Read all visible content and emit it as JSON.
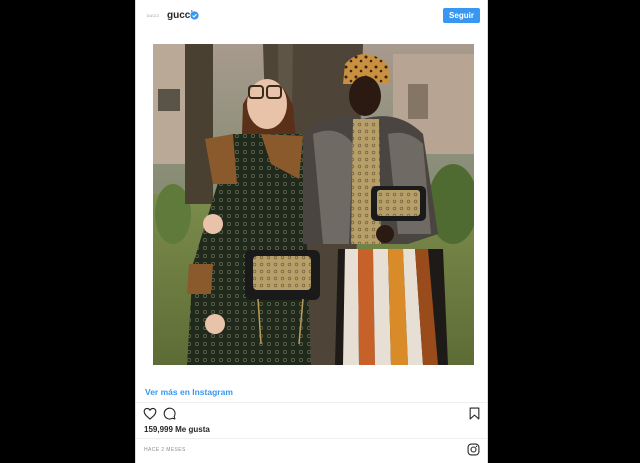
{
  "post": {
    "avatar_text": "GUCCI",
    "username": "gucci",
    "follow_label": "Seguir",
    "view_more_label": "Ver más en Instagram",
    "likes_text": "159,999 Me gusta",
    "timestamp": "HACE 2 MESES"
  },
  "colors": {
    "accent": "#3897f0",
    "text": "#262626",
    "muted": "#8e8e8e"
  },
  "icons": {
    "verified": "verified-badge-icon",
    "like": "heart-icon",
    "comment": "comment-icon",
    "save": "bookmark-icon",
    "brand": "instagram-icon"
  }
}
